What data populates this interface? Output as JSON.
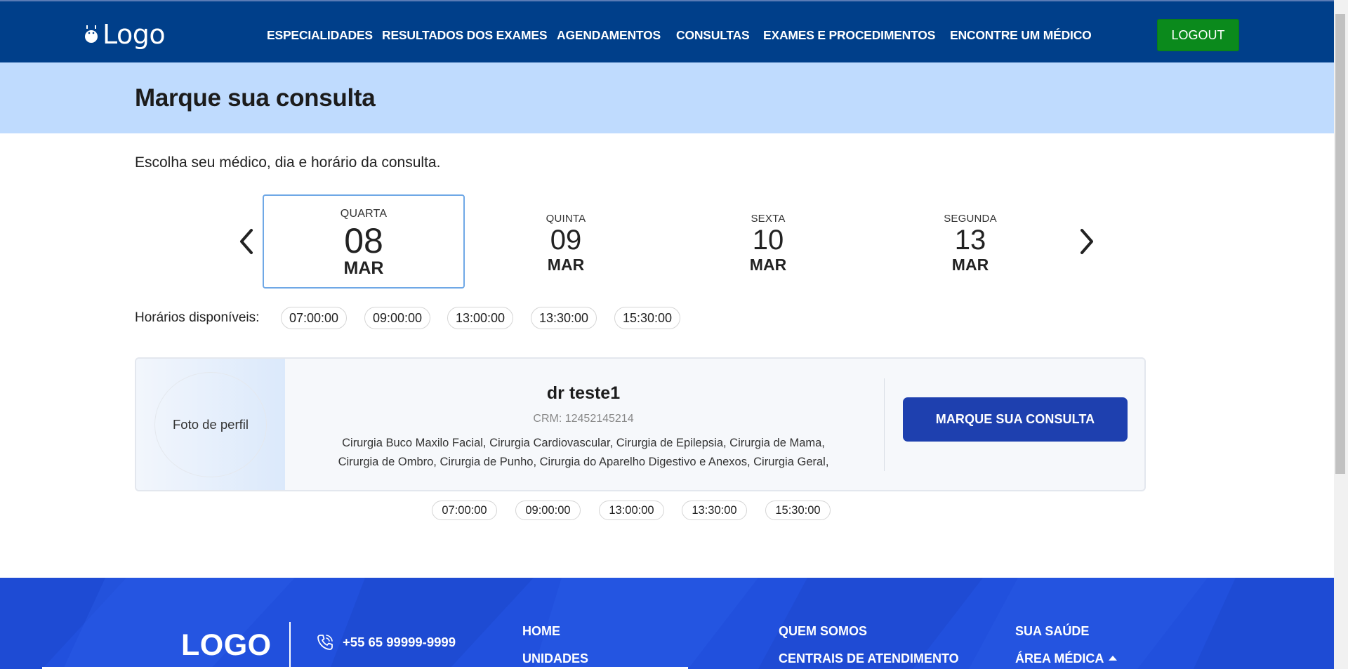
{
  "header": {
    "logo_text": "Logo",
    "nav": [
      {
        "label": "ESPECIALIDADES"
      },
      {
        "label": "RESULTADOS DOS EXAMES"
      },
      {
        "label": "AGENDAMENTOS"
      },
      {
        "label": "CONSULTAS"
      },
      {
        "label": "EXAMES E PROCEDIMENTOS"
      },
      {
        "label": "ENCONTRE UM MÉDICO"
      }
    ],
    "logout_label": "LOGOUT"
  },
  "page": {
    "title": "Marque sua consulta",
    "subtitle": "Escolha seu médico, dia e horário da consulta."
  },
  "dates": [
    {
      "dow": "QUARTA",
      "day": "08",
      "month": "MAR",
      "selected": true
    },
    {
      "dow": "QUINTA",
      "day": "09",
      "month": "MAR"
    },
    {
      "dow": "SEXTA",
      "day": "10",
      "month": "MAR"
    },
    {
      "dow": "SEGUNDA",
      "day": "13",
      "month": "MAR"
    }
  ],
  "available": {
    "label": "Horários disponíveis:",
    "slots": [
      "07:00:00",
      "09:00:00",
      "13:00:00",
      "13:30:00",
      "15:30:00"
    ]
  },
  "doctor": {
    "photo_label": "Foto de perfil",
    "name": "dr teste1",
    "crm": "CRM: 12452145214",
    "specialties_line1": "Cirurgia Buco Maxilo Facial, Cirurgia Cardiovascular, Cirurgia de Epilepsia, Cirurgia de Mama,",
    "specialties_line2": "Cirurgia de Ombro, Cirurgia de Punho, Cirurgia do Aparelho Digestivo e Anexos, Cirurgia Geral,",
    "book_label": "MARQUE SUA CONSULTA",
    "slots": [
      "07:00:00",
      "09:00:00",
      "13:00:00",
      "13:30:00",
      "15:30:00"
    ]
  },
  "footer": {
    "logo": "LOGO",
    "phone": "+55 65 99999-9999",
    "links": {
      "home": "HOME",
      "unidades": "UNIDADES",
      "quem_somos": "QUEM SOMOS",
      "centrais": "CENTRAIS DE ATENDIMENTO",
      "sua_saude": "SUA SAÚDE",
      "area_medica": "ÁREA MÉDICA"
    }
  },
  "colors": {
    "header_bg": "#003f8a",
    "title_band": "#bfdbfe",
    "logout_bg": "#0b8a1c",
    "book_btn": "#1e40af",
    "footer_bg": "#2150dd",
    "selected_border": "#6fa8e6"
  }
}
